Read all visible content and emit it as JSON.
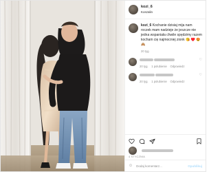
{
  "post": {
    "username": "kozi_6",
    "location": "Koszalin",
    "caption_user": "kozi_6",
    "caption_text": "Kochanie dzisiaj mija nam roczek mam nadzieje że jeszcze nie jedna wspaniała chwile spędzimy razem kocham cię najmocniej zionk 😘 ♥️ 😍 🙈",
    "caption_time": "20 tyg.",
    "comment_time": "20 tyg.",
    "comment_likes": "1 polubienie",
    "reply_label": "Odpowiedz",
    "date": "4 STYCZNIA",
    "add_comment_placeholder": "Dodaj komentarz...",
    "publish_label": "Opublikuj"
  },
  "icons": {
    "like": "heart-icon",
    "comment": "comment-icon",
    "share": "share-icon",
    "save": "bookmark-icon",
    "emoji": "smile-icon"
  }
}
